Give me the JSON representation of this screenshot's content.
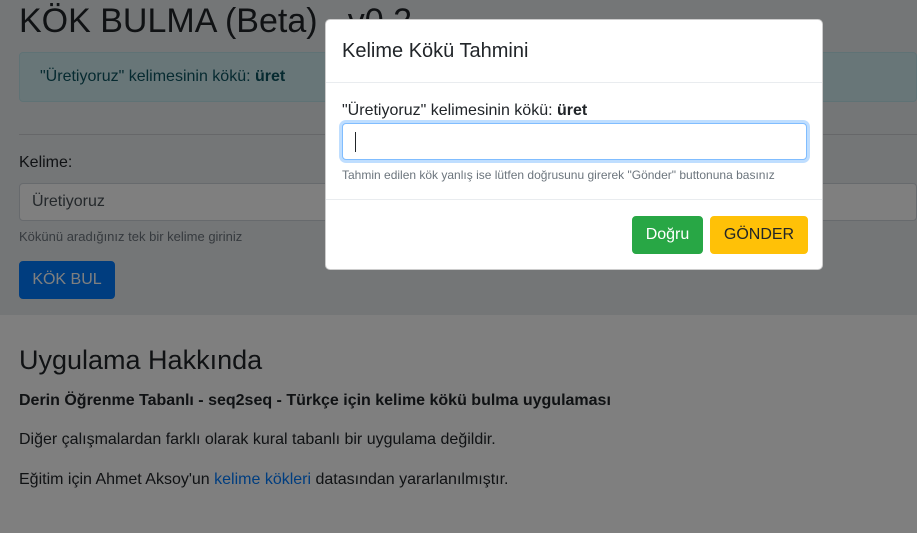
{
  "page": {
    "title": "KÖK BULMA (Beta) - v0.2",
    "alert": {
      "prefix": "\"Üretiyoruz\" kelimesinin kökü: ",
      "root": "üret"
    },
    "form": {
      "label": "Kelime:",
      "input_value": "Üretiyoruz",
      "help": "Kökünü aradığınız tek bir kelime giriniz",
      "button": "KÖK BUL"
    },
    "about": {
      "title": "Uygulama Hakkında",
      "subtitle": "Derin Öğrenme Tabanlı - seq2seq - Türkçe için kelime kökü bulma uygulaması",
      "p1": "Diğer çalışmalardan farklı olarak kural tabanlı bir uygulama değildir.",
      "p2_before": "Eğitim için Ahmet Aksoy'un ",
      "p2_link": "kelime kökleri",
      "p2_after": " datasından yararlanılmıştır."
    }
  },
  "modal": {
    "title": "Kelime Kökü Tahmini",
    "label_prefix": "\"Üretiyoruz\" kelimesinin kökü: ",
    "label_root": "üret",
    "input_value": "",
    "help": "Tahmin edilen kök yanlış ise lütfen doğrusunu girerek \"Gönder\" buttonuna basınız",
    "btn_correct": "Doğru",
    "btn_send": "GÖNDER"
  },
  "colors": {
    "primary": "#007bff",
    "success": "#28a745",
    "warning": "#ffc107",
    "info_bg": "#d1ecf1",
    "info_text": "#0c5460"
  }
}
